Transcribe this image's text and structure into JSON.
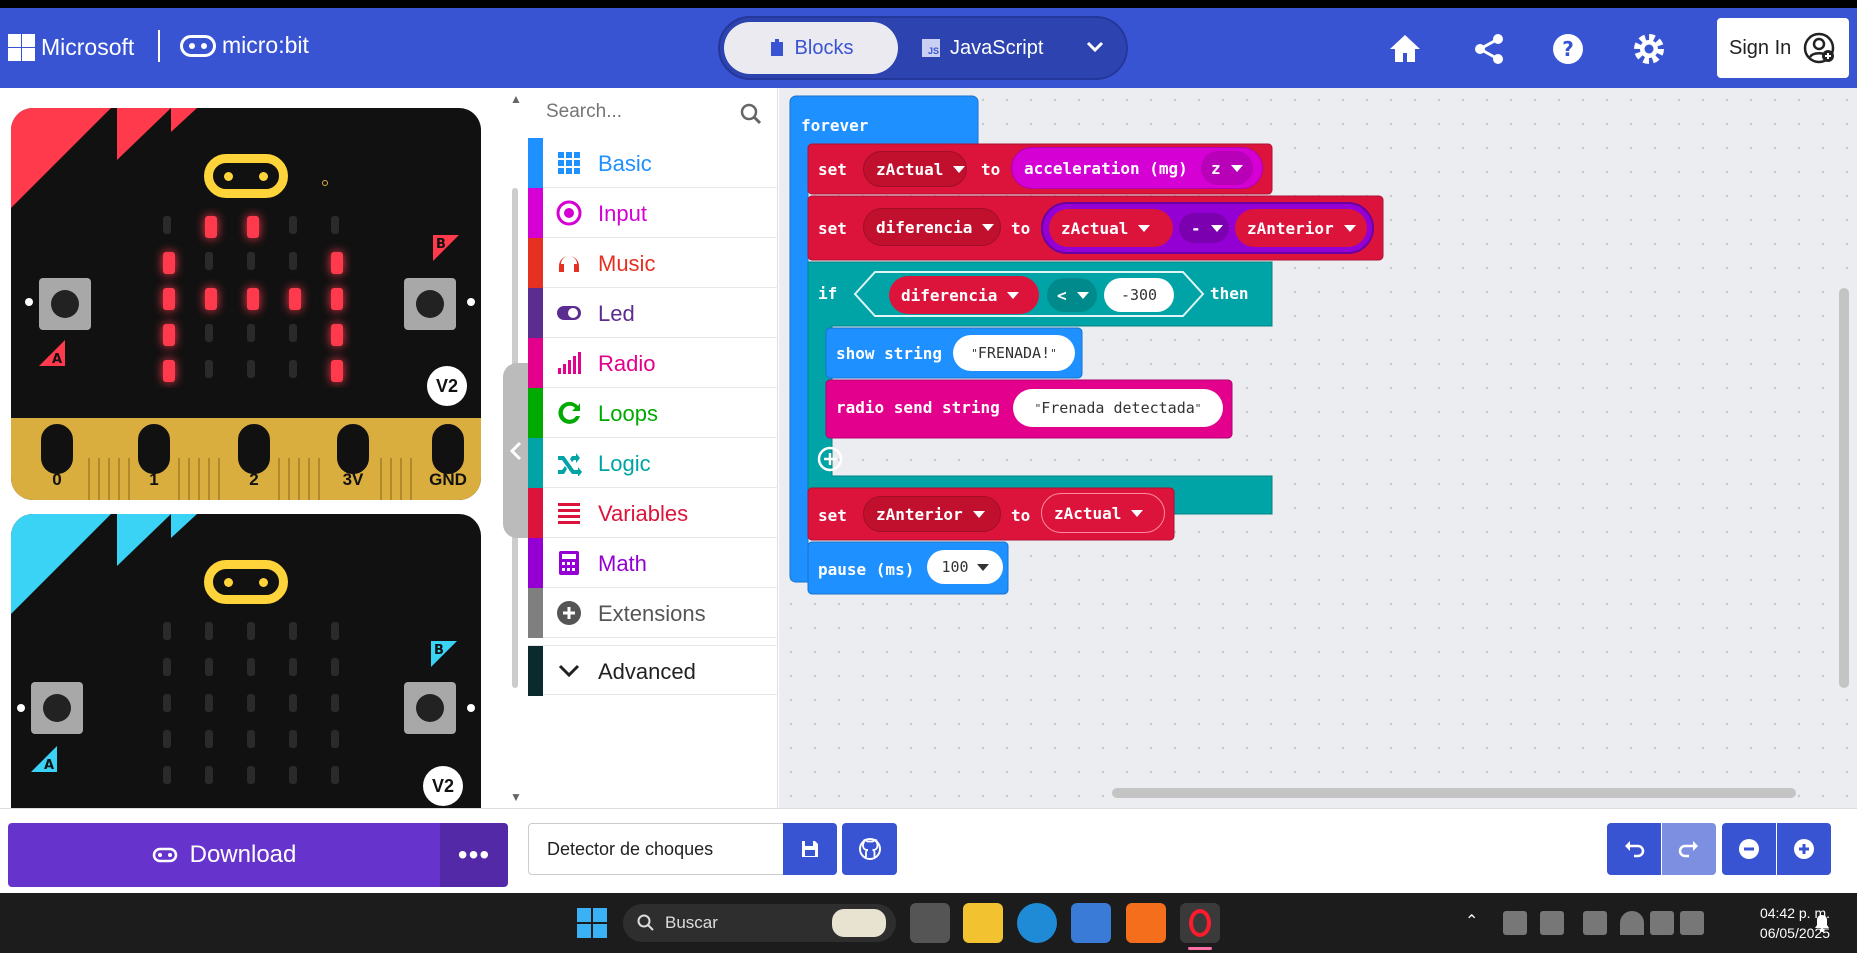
{
  "header": {
    "brand": "Microsoft",
    "product": "micro:bit",
    "mode_blocks": "Blocks",
    "mode_js": "JavaScript",
    "signin": "Sign In",
    "color": "#3954d3"
  },
  "simulator": {
    "pins": [
      "0",
      "1",
      "2",
      "3V",
      "GND"
    ],
    "button_a": "A",
    "button_b": "B",
    "version": "V2",
    "led_on_color": "#ff3a4c"
  },
  "toolbox": {
    "search_placeholder": "Search...",
    "categories": [
      {
        "label": "Basic",
        "color": "#1e90ff"
      },
      {
        "label": "Input",
        "color": "#d400d4"
      },
      {
        "label": "Music",
        "color": "#e63022"
      },
      {
        "label": "Led",
        "color": "#5c2d91"
      },
      {
        "label": "Radio",
        "color": "#e3008c"
      },
      {
        "label": "Loops",
        "color": "#00aa00"
      },
      {
        "label": "Logic",
        "color": "#00a4a6"
      },
      {
        "label": "Variables",
        "color": "#dc143c"
      },
      {
        "label": "Math",
        "color": "#9400d3"
      },
      {
        "label": "Extensions",
        "color": "#7f7f7f"
      },
      {
        "label": "Advanced",
        "color": "#222222"
      }
    ]
  },
  "code": {
    "forever": "forever",
    "set": "set",
    "to": "to",
    "var_zactual": "zActual",
    "acceleration": "acceleration (mg)",
    "axis": "z",
    "var_diferencia": "diferencia",
    "op_minus": "-",
    "var_zanterior": "zAnterior",
    "if": "if",
    "op_lt": "<",
    "threshold": "-300",
    "then": "then",
    "show_string": "show string",
    "str_frenada": "FRENADA!",
    "radio_send": "radio send string",
    "str_detectada": "Frenada detectada",
    "pause": "pause (ms)",
    "pause_value": "100"
  },
  "bottom": {
    "download": "Download",
    "more": "•••",
    "project_name": "Detector de choques"
  },
  "taskbar": {
    "search": "Buscar",
    "time": "04:42 p. m.",
    "date": "06/05/2025"
  }
}
